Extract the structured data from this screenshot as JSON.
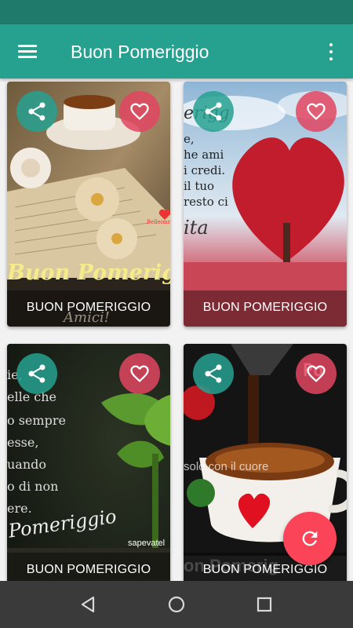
{
  "app": {
    "title": "Buon Pomeriggio"
  },
  "colors": {
    "primary": "#26a190",
    "primary_dark": "#1f7a6c",
    "favorite": "#e14560",
    "fab": "#fb4458",
    "navbar": "#3a3a3a"
  },
  "icons": {
    "menu": "hamburger-icon",
    "overflow": "more-vert-icon",
    "share": "share-icon",
    "favorite": "heart-outline-icon",
    "refresh": "refresh-icon",
    "back": "back-triangle-icon",
    "home": "home-circle-icon",
    "recents": "recents-square-icon"
  },
  "cards": [
    {
      "caption": "BUON POMERIGGIO",
      "overlay": [
        "Buon Pomerigg",
        "Amici!"
      ],
      "watermark": "Belleimmagini"
    },
    {
      "caption": "BUON POMERIGGIO",
      "overlay": [
        "erigg",
        "e,",
        "he ami",
        "i credi.",
        "il tuo",
        "resto ci",
        "ita"
      ]
    },
    {
      "caption": "BUON POMERIGGIO",
      "overlay": [
        "ie,",
        "elle che",
        "o sempre",
        "esse,",
        "uando",
        "o di non",
        "ere.",
        "Pomeriggio"
      ],
      "watermark": "sapevatel"
    },
    {
      "caption": "BUON POMERIGGIO",
      "overlay": [
        "Po",
        "solo con il cuore",
        "on Pomerig"
      ]
    }
  ]
}
